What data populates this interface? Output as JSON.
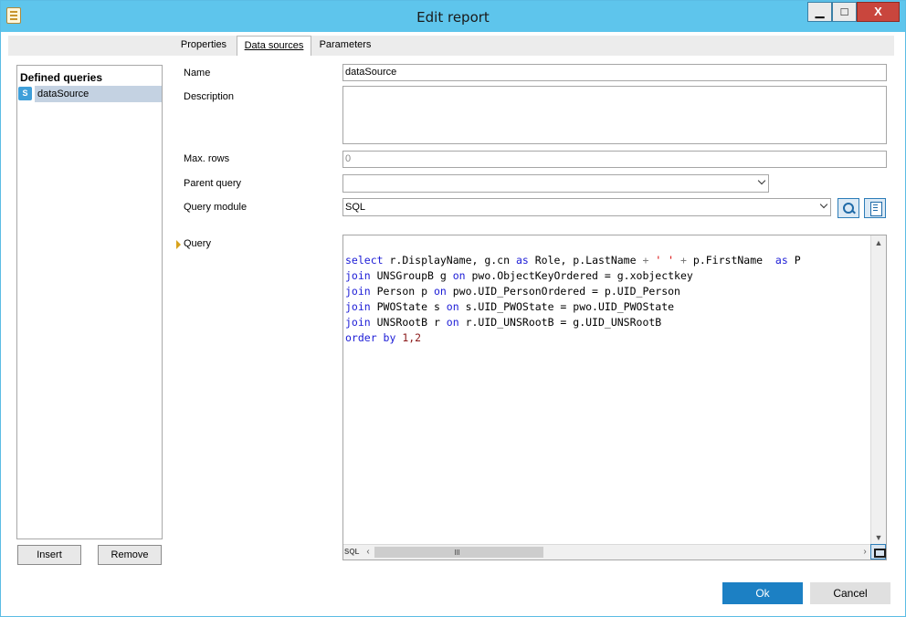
{
  "window": {
    "title": "Edit report",
    "minimize_label": "▁",
    "maximize_label": "□",
    "close_label": "X"
  },
  "tabs": [
    {
      "label": "Properties",
      "active": false
    },
    {
      "label": "Data sources",
      "active": true
    },
    {
      "label": "Parameters",
      "active": false
    }
  ],
  "left_panel": {
    "title": "Defined queries",
    "icon": "query-icon",
    "items": [
      {
        "label": "dataSource",
        "selected": true
      }
    ],
    "insert_label": "Insert",
    "remove_label": "Remove"
  },
  "form": {
    "name_label": "Name",
    "name_value": "dataSource",
    "description_label": "Description",
    "description_value": "",
    "max_rows_label": "Max. rows",
    "max_rows_value": "0",
    "parent_query_label": "Parent query",
    "parent_query_value": "",
    "query_module_label": "Query module",
    "query_module_value": "SQL",
    "query_label": "Query",
    "query_lines": [
      "select r.DisplayName, g.cn as Role, p.LastName + ' ' + p.FirstName  as P",
      "join UNSGroupB g on pwo.ObjectKeyOrdered = g.xobjectkey",
      "join Person p on pwo.UID_PersonOrdered = p.UID_Person",
      "join PWOState s on s.UID_PWOState = pwo.UID_PWOState",
      "join UNSRootB r on r.UID_UNSRootB = g.UID_UNSRootB",
      "order by 1,2"
    ],
    "editor_language_tag": "SQL"
  },
  "footer": {
    "ok_label": "Ok",
    "cancel_label": "Cancel"
  },
  "colors": {
    "titlebar": "#5ec5ec",
    "accent": "#1c80c4",
    "keyword": "#1b1bd6",
    "string": "#d80000"
  }
}
